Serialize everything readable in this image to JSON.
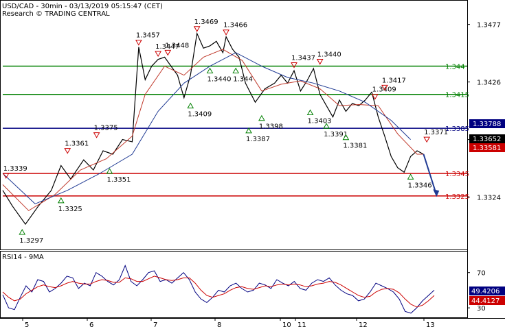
{
  "header": {
    "title": "USD/CAD - 30min - 03/13/2019 05:15:47 (CET)",
    "subtitle": "Research © TRADING CENTRAL"
  },
  "rsi": {
    "label": "RSI14 - 9MA",
    "value": "49.4206",
    "ma_value": "44.4127"
  },
  "chart_data": [
    {
      "type": "line",
      "panel": "price",
      "title": "USD/CAD - 30min - 03/13/2019 05:15:47 (CET)",
      "ylim": [
        1.328,
        1.3495
      ],
      "y_ticks": [
        "1.3477",
        "1.3426",
        "1.3375",
        "1.3324"
      ],
      "x_ticks": [
        "5",
        "6",
        "7",
        "8",
        "10",
        "11",
        "12",
        "13"
      ],
      "series": [
        {
          "name": "",
          "color": "#000000",
          "points": [
            [
              0,
              1.333
            ],
            [
              3,
              1.3316
            ],
            [
              7,
              1.33
            ],
            [
              11,
              1.3316
            ],
            [
              15,
              1.333
            ],
            [
              18,
              1.3352
            ],
            [
              21,
              1.334
            ],
            [
              25,
              1.3357
            ],
            [
              28,
              1.3348
            ],
            [
              31,
              1.3365
            ],
            [
              34,
              1.3362
            ],
            [
              37,
              1.3375
            ],
            [
              40,
              1.3373
            ],
            [
              42,
              1.3457
            ],
            [
              44,
              1.3428
            ],
            [
              46,
              1.344
            ],
            [
              48,
              1.3446
            ],
            [
              50,
              1.3448
            ],
            [
              52,
              1.344
            ],
            [
              54,
              1.3432
            ],
            [
              56,
              1.3412
            ],
            [
              58,
              1.3432
            ],
            [
              60,
              1.3469
            ],
            [
              62,
              1.3456
            ],
            [
              64,
              1.3458
            ],
            [
              66,
              1.3462
            ],
            [
              68,
              1.3452
            ],
            [
              69,
              1.3466
            ],
            [
              71,
              1.3455
            ],
            [
              73,
              1.3448
            ],
            [
              75,
              1.3425
            ],
            [
              78,
              1.3408
            ],
            [
              81,
              1.342
            ],
            [
              84,
              1.3425
            ],
            [
              86,
              1.3432
            ],
            [
              88,
              1.3425
            ],
            [
              90,
              1.3436
            ],
            [
              92,
              1.3418
            ],
            [
              94,
              1.3427
            ],
            [
              96,
              1.3438
            ],
            [
              98,
              1.3415
            ],
            [
              100,
              1.3405
            ],
            [
              102,
              1.3395
            ],
            [
              104,
              1.341
            ],
            [
              106,
              1.34
            ],
            [
              108,
              1.3407
            ],
            [
              110,
              1.3405
            ],
            [
              112,
              1.341
            ],
            [
              114,
              1.3417
            ],
            [
              116,
              1.3395
            ],
            [
              118,
              1.3378
            ],
            [
              120,
              1.336
            ],
            [
              122,
              1.335
            ],
            [
              124,
              1.3346
            ],
            [
              126,
              1.336
            ],
            [
              128,
              1.3365
            ],
            [
              130,
              1.3362
            ]
          ]
        },
        {
          "name": "",
          "color": "#c0392b",
          "points": [
            [
              0,
              1.3335
            ],
            [
              8,
              1.3312
            ],
            [
              16,
              1.3326
            ],
            [
              24,
              1.3348
            ],
            [
              32,
              1.3358
            ],
            [
              40,
              1.3378
            ],
            [
              44,
              1.3415
            ],
            [
              50,
              1.344
            ],
            [
              56,
              1.3432
            ],
            [
              62,
              1.3448
            ],
            [
              68,
              1.3455
            ],
            [
              74,
              1.3445
            ],
            [
              80,
              1.3418
            ],
            [
              86,
              1.3424
            ],
            [
              92,
              1.3427
            ],
            [
              98,
              1.342
            ],
            [
              104,
              1.3405
            ],
            [
              110,
              1.3406
            ],
            [
              116,
              1.3405
            ],
            [
              122,
              1.338
            ],
            [
              128,
              1.3362
            ],
            [
              130,
              1.3362
            ]
          ]
        },
        {
          "name": "",
          "color": "#1f3a93",
          "points": [
            [
              0,
              1.3345
            ],
            [
              10,
              1.3318
            ],
            [
              20,
              1.333
            ],
            [
              30,
              1.3345
            ],
            [
              40,
              1.3362
            ],
            [
              48,
              1.34
            ],
            [
              56,
              1.3425
            ],
            [
              64,
              1.344
            ],
            [
              72,
              1.3452
            ],
            [
              80,
              1.344
            ],
            [
              88,
              1.343
            ],
            [
              96,
              1.3425
            ],
            [
              104,
              1.3418
            ],
            [
              112,
              1.3408
            ],
            [
              120,
              1.3392
            ],
            [
              126,
              1.3375
            ]
          ]
        }
      ],
      "levels": [
        {
          "value": 1.344,
          "label": "1.344",
          "color": "#008000"
        },
        {
          "value": 1.3415,
          "label": "1.3415",
          "color": "#008000"
        },
        {
          "value": 1.3385,
          "label": "1.3385",
          "color": "#000080"
        },
        {
          "value": 1.3345,
          "label": "1.3345",
          "color": "#cc0000"
        },
        {
          "value": 1.3325,
          "label": "1.3325",
          "color": "#cc0000"
        }
      ],
      "right_labels": [
        {
          "value": 1.37788,
          "label": "1.33788",
          "color": "#000080"
        },
        {
          "value": 1.3365,
          "label": "1.33652",
          "color": "#000000"
        },
        {
          "value": 1.3358,
          "label": "1.33581",
          "color": "#cc0000"
        }
      ],
      "annotations": [
        {
          "x": 1,
          "y": 1.3339,
          "label": "1.3339",
          "type": "high"
        },
        {
          "x": 6,
          "y": 1.3297,
          "label": "1.3297",
          "type": "low"
        },
        {
          "x": 20,
          "y": 1.3361,
          "label": "1.3361",
          "type": "high"
        },
        {
          "x": 18,
          "y": 1.3325,
          "label": "1.3325",
          "type": "low"
        },
        {
          "x": 29,
          "y": 1.3375,
          "label": "1.3375",
          "type": "high"
        },
        {
          "x": 33,
          "y": 1.3351,
          "label": "1.3351",
          "type": "low"
        },
        {
          "x": 42,
          "y": 1.3457,
          "label": "1.3457",
          "type": "high"
        },
        {
          "x": 48,
          "y": 1.3447,
          "label": "1.3447",
          "type": "high"
        },
        {
          "x": 51,
          "y": 1.3448,
          "label": "1.3448",
          "type": "high"
        },
        {
          "x": 60,
          "y": 1.3469,
          "label": "1.3469",
          "type": "high"
        },
        {
          "x": 69,
          "y": 1.3466,
          "label": "1.3466",
          "type": "high"
        },
        {
          "x": 58,
          "y": 1.3409,
          "label": "1.3409",
          "type": "low"
        },
        {
          "x": 64,
          "y": 1.344,
          "label": "1.3440",
          "type": "low"
        },
        {
          "x": 72,
          "y": 1.344,
          "label": "1.344",
          "type": "low"
        },
        {
          "x": 76,
          "y": 1.3387,
          "label": "1.3387",
          "type": "low"
        },
        {
          "x": 80,
          "y": 1.3398,
          "label": "1.3398",
          "type": "low"
        },
        {
          "x": 90,
          "y": 1.3437,
          "label": "1.3437",
          "type": "high"
        },
        {
          "x": 98,
          "y": 1.344,
          "label": "1.3440",
          "type": "high"
        },
        {
          "x": 95,
          "y": 1.3403,
          "label": "1.3403",
          "type": "low"
        },
        {
          "x": 100,
          "y": 1.3391,
          "label": "1.3391",
          "type": "low"
        },
        {
          "x": 106,
          "y": 1.3381,
          "label": "1.3381",
          "type": "low"
        },
        {
          "x": 115,
          "y": 1.3409,
          "label": "1.3409",
          "type": "high"
        },
        {
          "x": 118,
          "y": 1.3417,
          "label": "1.3417",
          "type": "high"
        },
        {
          "x": 126,
          "y": 1.3346,
          "label": "1.3346",
          "type": "low"
        },
        {
          "x": 131,
          "y": 1.3371,
          "label": "1.3371",
          "type": "high"
        }
      ]
    },
    {
      "type": "line",
      "panel": "rsi",
      "title": "RSI14 - 9MA",
      "ylim": [
        20,
        90
      ],
      "y_ticks": [
        "70",
        "30"
      ],
      "series": [
        {
          "name": "RSI14",
          "color": "#000080",
          "values": [
            45,
            30,
            28,
            42,
            55,
            48,
            62,
            60,
            48,
            52,
            58,
            66,
            64,
            52,
            58,
            55,
            70,
            66,
            60,
            56,
            62,
            78,
            60,
            55,
            62,
            70,
            72,
            60,
            62,
            58,
            64,
            70,
            62,
            48,
            40,
            36,
            42,
            50,
            48,
            55,
            58,
            52,
            48,
            50,
            58,
            56,
            52,
            62,
            58,
            55,
            60,
            52,
            50,
            58,
            62,
            60,
            64,
            56,
            50,
            46,
            44,
            38,
            40,
            48,
            58,
            55,
            52,
            48,
            40,
            26,
            24,
            30,
            38,
            44,
            50
          ]
        },
        {
          "name": "9MA",
          "color": "#cc0000",
          "values": [
            48,
            42,
            38,
            40,
            46,
            50,
            54,
            56,
            54,
            53,
            55,
            58,
            60,
            58,
            57,
            57,
            60,
            62,
            61,
            59,
            59,
            64,
            63,
            60,
            60,
            63,
            66,
            64,
            62,
            61,
            62,
            64,
            64,
            58,
            50,
            44,
            42,
            44,
            46,
            50,
            53,
            54,
            52,
            51,
            53,
            55,
            54,
            56,
            57,
            56,
            57,
            56,
            54,
            55,
            57,
            58,
            60,
            59,
            56,
            52,
            48,
            44,
            42,
            43,
            48,
            51,
            52,
            51,
            47,
            40,
            34,
            31,
            33,
            38,
            44
          ]
        }
      ]
    }
  ]
}
